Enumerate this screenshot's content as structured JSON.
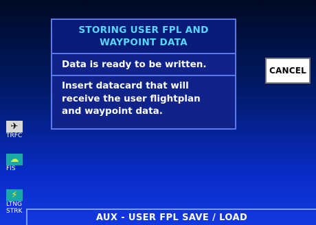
{
  "dialog": {
    "title_line1": "STORING USER FPL AND",
    "title_line2": "WAYPOINT DATA",
    "status": "Data is ready to be written.",
    "instruction_line1": "Insert datacard that will",
    "instruction_line2": "receive the user flightplan",
    "instruction_line3": "and waypoint data."
  },
  "softkeys": {
    "cancel_label": "CANCEL"
  },
  "sidebar": {
    "items": [
      {
        "label": "TRFC",
        "icon": "airplane-traffic-icon"
      },
      {
        "label": "FIS",
        "icon": "weather-fis-icon"
      },
      {
        "label_line1": "LTNG",
        "label_line2": "STRK",
        "icon": "lightning-icon"
      }
    ]
  },
  "footer": {
    "page_title": "AUX - USER FPL SAVE / LOAD"
  },
  "colors": {
    "title_text": "#56d8ff",
    "panel_border": "#5a78f0",
    "panel_fill": "#10238a",
    "icon_cyan": "#18a8a8",
    "lightning_yellow": "#ffe600"
  }
}
